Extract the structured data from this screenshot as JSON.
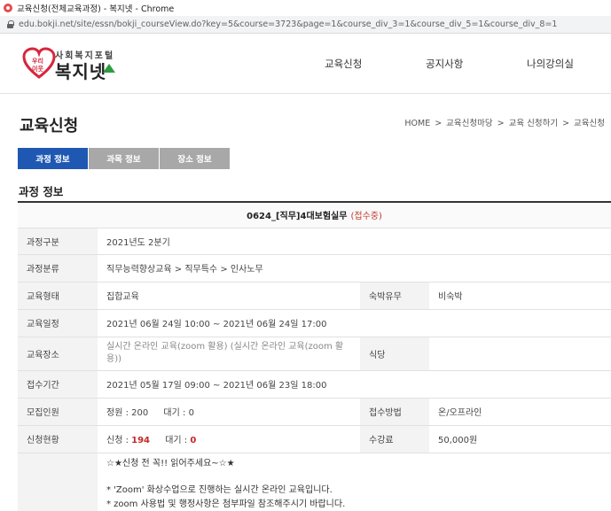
{
  "browser": {
    "window_title": "교육신청(전체교육과정) - 복지넷 - Chrome",
    "url": "edu.bokji.net/site/essn/bokji_courseView.do?key=5&course=3723&page=1&course_div_3=1&course_div_5=1&course_div_8=1"
  },
  "site": {
    "logo_small": "사회복지포털",
    "logo_name": "복지넷",
    "nav": [
      "교육신청",
      "공지사항",
      "나의강의실"
    ]
  },
  "page": {
    "title": "교육신청",
    "breadcrumb": [
      "HOME",
      "교육신청마당",
      "교육 신청하기",
      "교육신청"
    ],
    "breadcrumb_sep": ">",
    "tabs": [
      {
        "label": "과정 정보",
        "active": true
      },
      {
        "label": "과목 정보",
        "active": false
      },
      {
        "label": "장소 정보",
        "active": false
      }
    ],
    "section_title": "과정 정보"
  },
  "course": {
    "name": "0624_[직무]4대보험실무",
    "status": "(접수중)",
    "rows": {
      "category_label": "과정구분",
      "category": "2021년도 2분기",
      "classification_label": "과정분류",
      "classification": "직무능력향상교육 > 직무특수 > 인사노무",
      "format_label": "교육형태",
      "format": "집합교육",
      "lodging_label": "숙박유무",
      "lodging": "비숙박",
      "schedule_label": "교육일정",
      "schedule": "2021년 06월 24일 10:00 ~ 2021년 06월 24일 17:00",
      "venue_label": "교육장소",
      "venue": "실시간 온라인 교육(zoom 활용) (실시간 온라인 교육(zoom 활용))",
      "meal_label": "식당",
      "meal": "",
      "reg_period_label": "접수기간",
      "reg_period": "2021년 05월 17일 09:00 ~ 2021년 06월 23일 18:00",
      "capacity_label": "모집인원",
      "capacity_quota_label": "정원 :",
      "capacity_quota": "200",
      "capacity_wait_label": "대기 :",
      "capacity_wait": "0",
      "method_label": "접수방법",
      "method": "온/오프라인",
      "status_label": "신청현황",
      "applied_label": "신청 :",
      "applied": "194",
      "waiting_label": "대기 :",
      "waiting": "0",
      "fee_label": "수강료",
      "fee": "50,000원",
      "notice_lines": [
        "☆★신청 전 꼭!! 읽어주세요~☆★",
        "",
        "* 'Zoom' 화상수업으로 진행하는 실시간 온라인 교육입니다.",
        "* zoom 사용법 및 행정사항은 첨부파일 참조해주시기 바랍니다."
      ]
    }
  },
  "colors": {
    "tab_active": "#1f58b3",
    "tab_inactive": "#a8a8a8",
    "accent_red": "#c62828"
  }
}
